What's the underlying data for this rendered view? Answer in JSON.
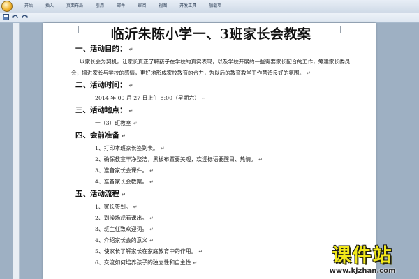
{
  "ribbon": {
    "tabs": [
      "开始",
      "插入",
      "页面布局",
      "引用",
      "邮件",
      "审阅",
      "视图",
      "开发工具",
      "加载项"
    ]
  },
  "quick_access": {
    "icons": [
      "save-icon",
      "undo-icon",
      "redo-icon"
    ]
  },
  "document": {
    "title": "临沂朱陈小学一、3班家长会教案",
    "paragraph_mark": "↵",
    "sections": [
      {
        "heading": "一、活动目的：",
        "lines": [],
        "paragraph": "以家长会为契机，让家长真正了解孩子在学校的真实表现，以及学校开展的一些需要家长配合的工作，筹建家长委员会，增进家长与学校的感情，更好地形成家校教育的合力，为以后的教育教学工作营造良好的氛围。"
      },
      {
        "heading": "二、活动时间：",
        "lines": [
          "2014 年 09 月 27 日上午 8:00（星期六）"
        ]
      },
      {
        "heading": "三、活动地点：",
        "lines": [
          "一（3）班教室"
        ]
      },
      {
        "heading": "四、会前准备",
        "lines": [
          "1、打印本班家长签到表。",
          "2、确保教室干净整洁，黑板布置要美观，欢迎标语要醒目、热情。",
          "3、准备家长会课件。",
          "4、准备家长会教案。"
        ]
      },
      {
        "heading": "五、活动流程",
        "lines": [
          "1、家长签到。",
          "2、到操场观看课出。",
          "3、班主任致欢迎词。",
          "4、介绍家长会的意义",
          "5、使家长了解家长在家庭教育中的作用。",
          "6、交流如何培养孩子的独立性和自主性"
        ]
      }
    ]
  },
  "watermark": {
    "name": "课件站",
    "url": "www.kjzhan.com"
  },
  "colors": {
    "ribbon": "#dbe5f1",
    "workspace": "#9eb0c3",
    "page": "#ffffff",
    "logo_text": "#f2e81a"
  }
}
